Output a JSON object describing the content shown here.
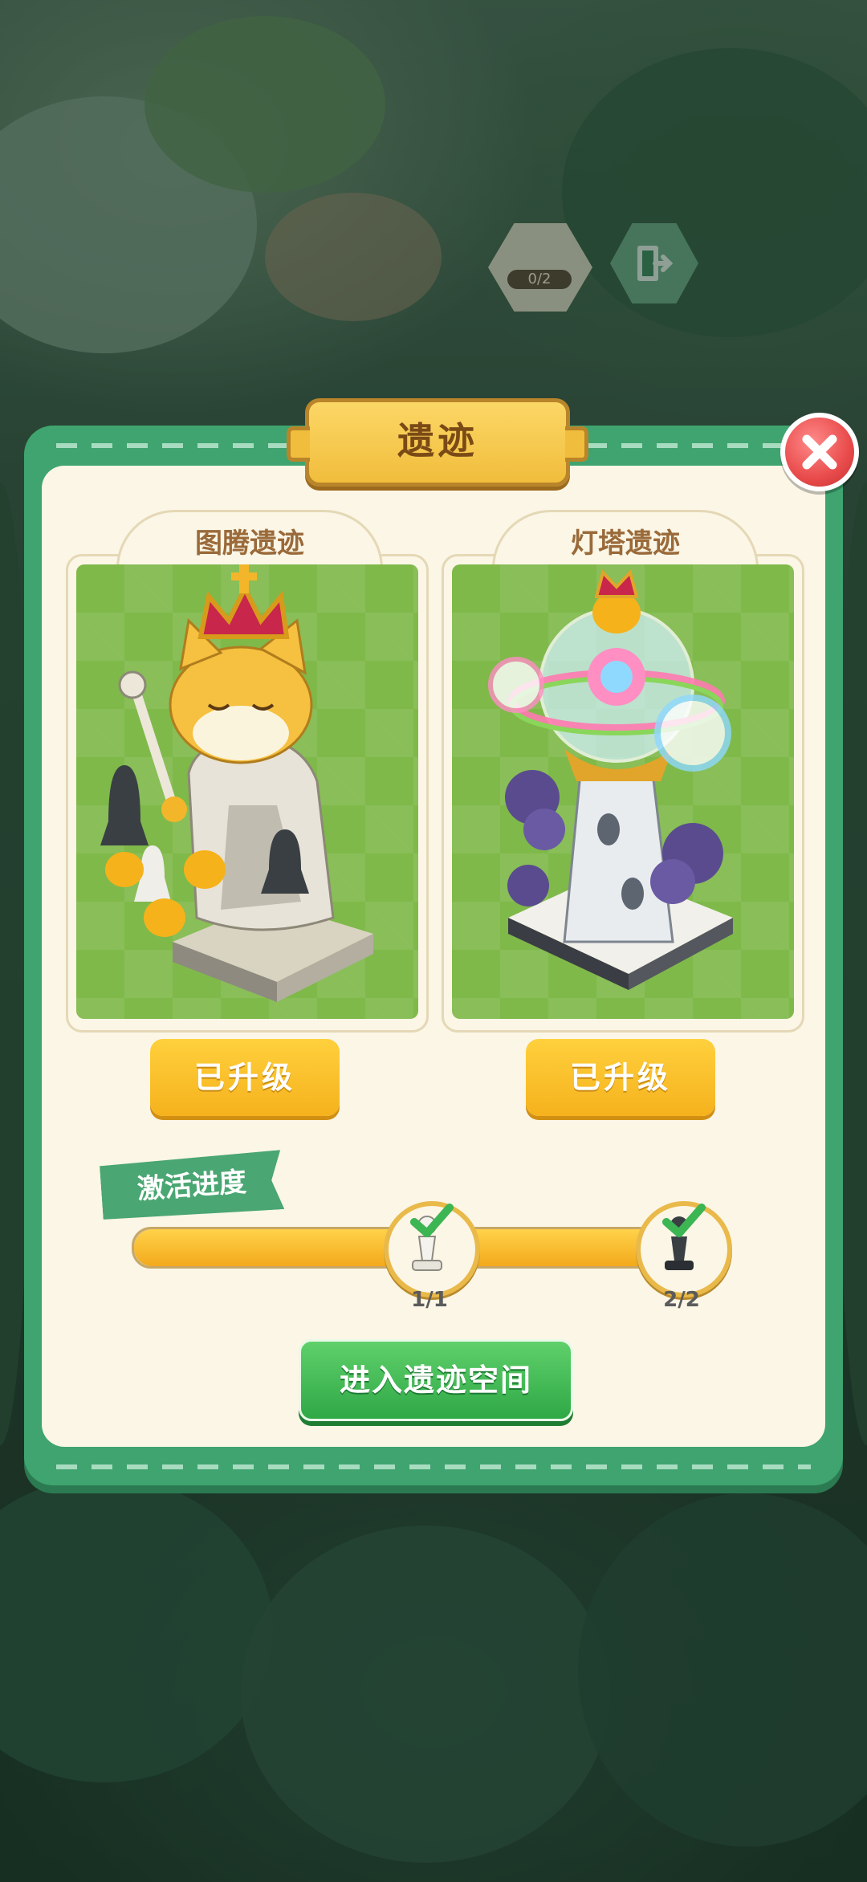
{
  "hud": {
    "relic_progress": "0/2"
  },
  "dialog": {
    "title": "遗迹",
    "relics": [
      {
        "name": "图腾遗迹",
        "button_label": "已升级",
        "image": "crowned-cat-chess-statue"
      },
      {
        "name": "灯塔遗迹",
        "button_label": "已升级",
        "image": "crowned-lighthouse-statue"
      }
    ],
    "progress": {
      "label": "激活进度",
      "fill_fraction": 1.0,
      "milestones": [
        {
          "count": "1/1",
          "piece": "white-pawn",
          "completed": true
        },
        {
          "count": "2/2",
          "piece": "black-pawn",
          "completed": true
        }
      ]
    },
    "enter_button_label": "进入遗迹空间"
  },
  "colors": {
    "frame_green": "#3fa46f",
    "accent_yellow": "#f5b21d",
    "button_green": "#2fa846",
    "close_red": "#e94b4b"
  }
}
